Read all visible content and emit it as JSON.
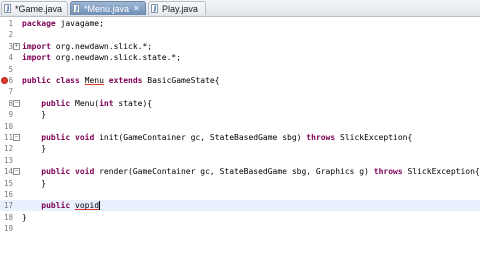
{
  "tabs": [
    {
      "label": "*Game.java",
      "close": ""
    },
    {
      "label": "*Menu.java",
      "close": "✕"
    },
    {
      "label": "Play.java",
      "close": ""
    }
  ],
  "lines": [
    {
      "num": "1",
      "text": "package javagame;",
      "kw": "package"
    },
    {
      "num": "2",
      "text": ""
    },
    {
      "num": "3",
      "text": "import org.newdawn.slick.*;",
      "kw": "import",
      "fold": "+"
    },
    {
      "num": "4",
      "text": "import org.newdawn.slick.state.*;",
      "kw": "import"
    },
    {
      "num": "5",
      "text": ""
    },
    {
      "num": "6",
      "text": "public class Menu extends BasicGameState{"
    },
    {
      "num": "7",
      "text": ""
    },
    {
      "num": "8",
      "text": "    public Menu(int state){"
    },
    {
      "num": "9",
      "text": "    }"
    },
    {
      "num": "10",
      "text": ""
    },
    {
      "num": "11",
      "text": "    public void init(GameContainer gc, StateBasedGame sbg) throws SlickException{"
    },
    {
      "num": "12",
      "text": "    }"
    },
    {
      "num": "13",
      "text": ""
    },
    {
      "num": "14",
      "text": "    public void render(GameContainer gc, StateBasedGame sbg, Graphics g) throws SlickException{"
    },
    {
      "num": "15",
      "text": "    }"
    },
    {
      "num": "16",
      "text": ""
    },
    {
      "num": "17",
      "text": "    public vopid"
    },
    {
      "num": "18",
      "text": "}"
    },
    {
      "num": "19",
      "text": ""
    }
  ],
  "colors": {
    "keyword": "#7f0055",
    "error": "#e53b2f",
    "tab_active": "#7e9bc2"
  }
}
